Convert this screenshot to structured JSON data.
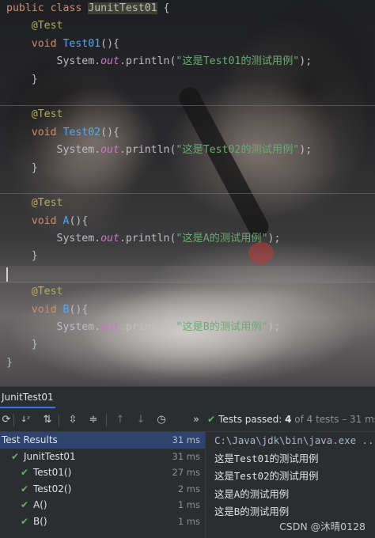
{
  "editor": {
    "lines": [
      {
        "type": "class",
        "kw1": "public",
        "kw2": "class",
        "name": "JunitTest01",
        "brace": " {"
      },
      {
        "type": "ann",
        "text": "@Test"
      },
      {
        "type": "method",
        "kw": "void",
        "name": "Test01",
        "tail": "(){"
      },
      {
        "type": "print",
        "obj": "System.",
        "field": "out",
        "call": ".println(",
        "str": "\"这是Test01的测试用例\"",
        "end": ");"
      },
      {
        "type": "close",
        "text": "}"
      },
      {
        "type": "blank"
      },
      {
        "type": "ann",
        "text": "@Test"
      },
      {
        "type": "method",
        "kw": "void",
        "name": "Test02",
        "tail": "(){"
      },
      {
        "type": "print",
        "obj": "System.",
        "field": "out",
        "call": ".println(",
        "str": "\"这是Test02的测试用例\"",
        "end": ");"
      },
      {
        "type": "close",
        "text": "}"
      },
      {
        "type": "blank"
      },
      {
        "type": "ann",
        "text": "@Test"
      },
      {
        "type": "method",
        "kw": "void",
        "name": "A",
        "tail": "(){"
      },
      {
        "type": "print",
        "obj": "System.",
        "field": "out",
        "call": ".println(",
        "str": "\"这是A的测试用例\"",
        "end": ");"
      },
      {
        "type": "close",
        "text": "}"
      },
      {
        "type": "blank"
      },
      {
        "type": "ann",
        "text": "@Test"
      },
      {
        "type": "method",
        "kw": "void",
        "name": "B",
        "tail": "(){"
      },
      {
        "type": "print",
        "obj": "System.",
        "field": "out",
        "call": ".println(",
        "str": "\"这是B的测试用例\"",
        "end": ");"
      },
      {
        "type": "close",
        "text": "}"
      },
      {
        "type": "classclose",
        "text": "}"
      }
    ]
  },
  "run_panel": {
    "tab_label": "JunitTest01",
    "toolbar_icons": [
      "rerun-icon",
      "sort-alpha-icon",
      "sort-duration-icon",
      "expand-all-icon",
      "collapse-all-icon",
      "more-icon",
      "prev-failed-icon",
      "next-failed-icon",
      "history-icon"
    ],
    "status": {
      "check": "✔",
      "prefix": "Tests passed: ",
      "passed": "4",
      "suffix": " of 4 tests – 31 ms"
    },
    "tree": [
      {
        "label": "Test Results",
        "time": "31 ms",
        "indent": 0,
        "check": false,
        "selected": true
      },
      {
        "label": "JunitTest01",
        "time": "31 ms",
        "indent": 1,
        "check": true,
        "selected": false
      },
      {
        "label": "Test01()",
        "time": "27 ms",
        "indent": 2,
        "check": true,
        "selected": false
      },
      {
        "label": "Test02()",
        "time": "2 ms",
        "indent": 2,
        "check": true,
        "selected": false
      },
      {
        "label": "A()",
        "time": "1 ms",
        "indent": 2,
        "check": true,
        "selected": false
      },
      {
        "label": "B()",
        "time": "1 ms",
        "indent": 2,
        "check": true,
        "selected": false
      }
    ],
    "console": [
      "C:\\Java\\jdk\\bin\\java.exe ...",
      "这是Test01的测试用例",
      "这是Test02的测试用例",
      "这是A的测试用例",
      "这是B的测试用例"
    ],
    "watermark": "CSDN @沐晴0128"
  },
  "colors": {
    "keyword": "#cf8e6d",
    "annotation": "#b3ae60",
    "method": "#56a8f5",
    "string": "#6aab73",
    "static_field": "#c77dbb",
    "pass_green": "#5fb865",
    "selection": "#2e436e"
  }
}
